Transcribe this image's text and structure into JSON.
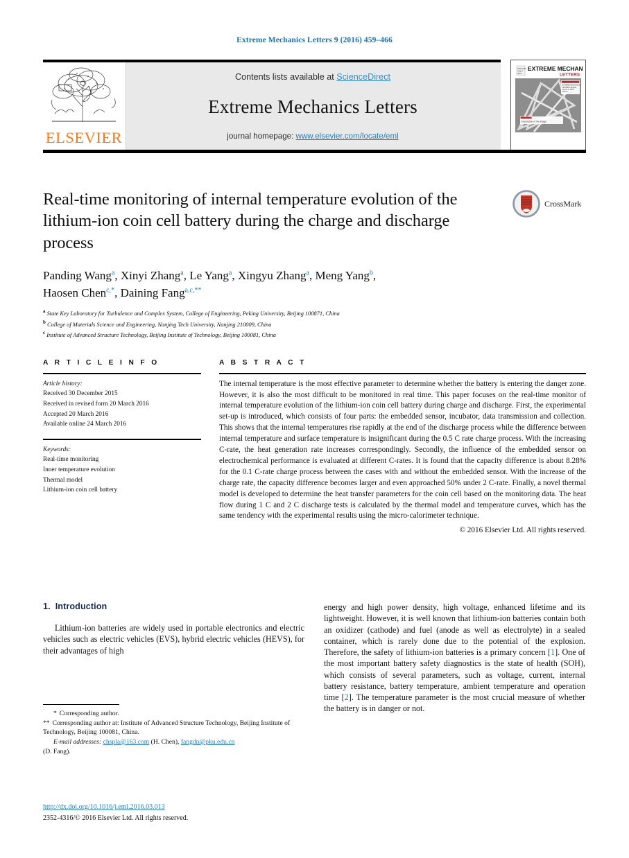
{
  "running_head": "Extreme Mechanics Letters 9 (2016) 459–466",
  "masthead": {
    "contents_prefix": "Contents lists available at ",
    "sciencedirect": "ScienceDirect",
    "journal_title": "Extreme Mechanics Letters",
    "homepage_prefix": "journal homepage: ",
    "homepage_url": "www.elsevier.com/locate/eml",
    "publisher_wordmark": "ELSEVIER",
    "cover": {
      "title_line1": "EXTREME MECHANICS",
      "title_line2": "LETTERS",
      "caption": "Description of the image"
    }
  },
  "article": {
    "title": "Real-time monitoring of internal temperature evolution of the lithium-ion coin cell battery during the charge and discharge process",
    "authors_line1": "Panding Wang a, Xinyi Zhang a, Le Yang a, Xingyu Zhang a, Meng Yang b,",
    "authors_line2": "Haosen Chen c,*, Daining Fang a,c,**",
    "authors": [
      {
        "name": "Panding Wang",
        "sup": "a",
        "sep": ", "
      },
      {
        "name": "Xinyi Zhang",
        "sup": "a",
        "sep": ", "
      },
      {
        "name": "Le Yang",
        "sup": "a",
        "sep": ", "
      },
      {
        "name": "Xingyu Zhang",
        "sup": "a",
        "sep": ", "
      },
      {
        "name": "Meng Yang",
        "sup": "b",
        "sep": ","
      },
      {
        "name": "Haosen Chen",
        "sup": "c,*",
        "sep": ", "
      },
      {
        "name": "Daining Fang",
        "sup": "a,c,**",
        "sep": ""
      }
    ],
    "affiliations": [
      {
        "mark": "a",
        "text": "State Key Laboratory for Turbulence and Complex System, College of Engineering, Peking University, Beijing 100871, China"
      },
      {
        "mark": "b",
        "text": "College of Materials Science and Engineering, Nanjing Tech University, Nanjing 210009, China"
      },
      {
        "mark": "c",
        "text": "Institute of Advanced Structure Technology, Beijing Institute of Technology, Beijing 100081, China"
      }
    ],
    "crossmark_label": "CrossMark"
  },
  "article_info": {
    "heading": "A R T I C L E    I N F O",
    "history_label": "Article history:",
    "history": [
      "Received 30 December 2015",
      "Received in revised form 20 March 2016",
      "Accepted 20 March 2016",
      "Available online 24 March 2016"
    ],
    "keywords_label": "Keywords:",
    "keywords": [
      "Real-time monitoring",
      "Inner temperature evolution",
      "Thermal model",
      "Lithium-ion coin cell battery"
    ]
  },
  "abstract": {
    "heading": "A B S T R A C T",
    "text": "The internal temperature is the most effective parameter to determine whether the battery is entering the danger zone. However, it is also the most difficult to be monitored in real time. This paper focuses on the real-time monitor of internal temperature evolution of the lithium-ion coin cell battery during charge and discharge. First, the experimental set-up is introduced, which consists of four parts: the embedded sensor, incubator, data transmission and collection. This shows that the internal temperatures rise rapidly at the end of the discharge process while the difference between internal temperature and surface temperature is insignificant during the 0.5 C rate charge process. With the increasing C-rate, the heat generation rate increases correspondingly. Secondly, the influence of the embedded sensor on electrochemical performance is evaluated at different C-rates. It is found that the capacity difference is about 8.28% for the 0.1 C-rate charge process between the cases with and without the embedded sensor. With the increase of the charge rate, the capacity difference becomes larger and even approached 50% under 2 C-rate. Finally, a novel thermal model is developed to determine the heat transfer parameters for the coin cell based on the monitoring data. The heat flow during 1 C and 2 C discharge tests is calculated by the thermal model and temperature curves, which has the same tendency with the experimental results using the micro-calorimeter technique.",
    "copyright": "© 2016 Elsevier Ltd. All rights reserved."
  },
  "introduction": {
    "number": "1.",
    "title": "Introduction",
    "left_paragraph": "Lithium-ion batteries are widely used in portable electronics and electric vehicles such as electric vehicles (EVS), hybrid electric vehicles (HEVS), for their advantages of high",
    "right_paragraph_a": "energy and high power density, high voltage, enhanced lifetime and its lightweight. However, it is well known that lithium-ion batteries contain both an oxidizer (cathode) and fuel (anode as well as electrolyte) in a sealed container, which is rarely done due to the potential of the explosion. Therefore, the safety of lithium-ion batteries is a primary concern [",
    "right_ref_1": "1",
    "right_paragraph_b": "]. One  of the most important battery safety diagnostics is the state of health (SOH), which consists of several parameters, such as voltage, current, internal battery resistance, battery temperature, ambient temperature and operation time [",
    "right_ref_2": "2",
    "right_paragraph_c": "]. The temperature parameter is the most crucial measure of whether the battery is in danger or not."
  },
  "footnotes": {
    "star_mark": "*",
    "star_text": "Corresponding author.",
    "dstar_mark": "**",
    "dstar_text": "Corresponding author at: Institute of Advanced Structure Technology, Beijing Institute of Technology, Beijing 100081, China.",
    "email_label": "E-mail addresses:",
    "email_1": "chspla@163.com",
    "email_1_owner": " (H. Chen), ",
    "email_2": "fangdn@pku.edu.cn",
    "email_2_owner": "(D. Fang)."
  },
  "imprint": {
    "doi": "http://dx.doi.org/10.1016/j.eml.2016.03.013",
    "issn_line": "2352-4316/© 2016 Elsevier Ltd. All rights reserved."
  },
  "colors": {
    "link": "#2a7fb8",
    "sciencedirect": "#3a8fc4",
    "elsevier_orange": "#f47c20",
    "section_heading": "#1a2a52",
    "running_head": "#1f6fa8"
  }
}
